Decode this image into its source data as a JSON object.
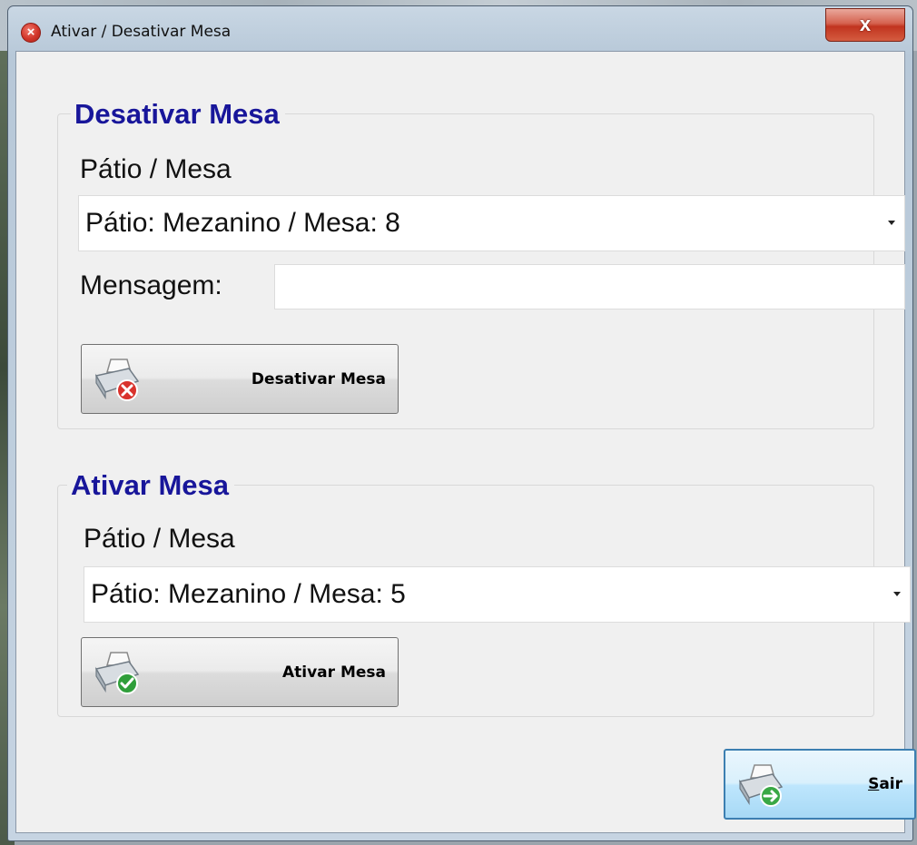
{
  "window": {
    "title": "Ativar / Desativar Mesa",
    "close_glyph": "x"
  },
  "deactivate": {
    "group_title": "Desativar Mesa",
    "patio_label": "Pátio / Mesa",
    "selected_value": "Pátio: Mezanino / Mesa: 8",
    "message_label": "Mensagem:",
    "message_value": "",
    "button_label": "Desativar Mesa"
  },
  "activate": {
    "group_title": "Ativar Mesa",
    "patio_label": "Pátio / Mesa",
    "selected_value": "Pátio: Mezanino / Mesa: 5",
    "button_label": "Ativar Mesa"
  },
  "exit": {
    "button_label_mnemonic": "S",
    "button_label_rest": "air"
  },
  "icons": {
    "title": "error-circle-icon",
    "deactivate": "printer-x-icon",
    "activate": "printer-check-icon",
    "exit": "printer-arrow-icon"
  },
  "colors": {
    "group_title": "#18169a",
    "deactivate_badge": "#d9322c",
    "activate_badge": "#2f9e3a",
    "exit_badge": "#39a845"
  }
}
